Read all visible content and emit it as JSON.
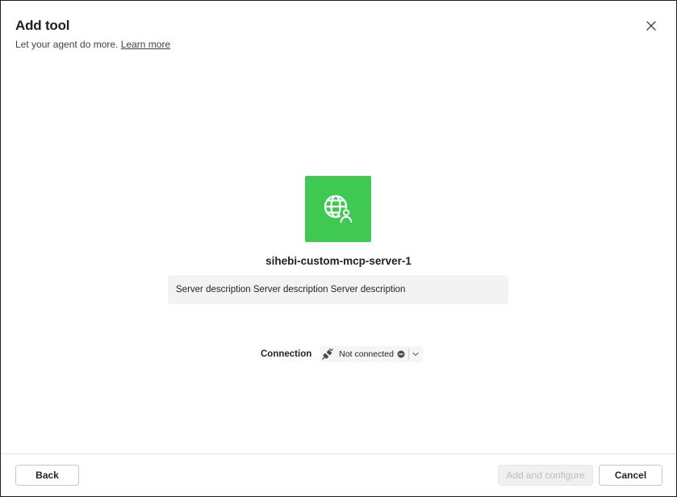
{
  "dialog": {
    "title": "Add tool",
    "subtitle": "Let your agent do more.",
    "learn_more": "Learn more",
    "close_icon": "close-icon"
  },
  "tool": {
    "icon": "globe-person-icon",
    "icon_bg_color": "#3fc852",
    "name": "sihebi-custom-mcp-server-1",
    "description": "Server description Server description Server description"
  },
  "connection": {
    "label": "Connection",
    "status": "Not connected",
    "status_icon": "minus-circle-icon",
    "plug_icon": "plug-disconnected-icon"
  },
  "footer": {
    "back_label": "Back",
    "add_label": "Add and configure",
    "cancel_label": "Cancel"
  }
}
